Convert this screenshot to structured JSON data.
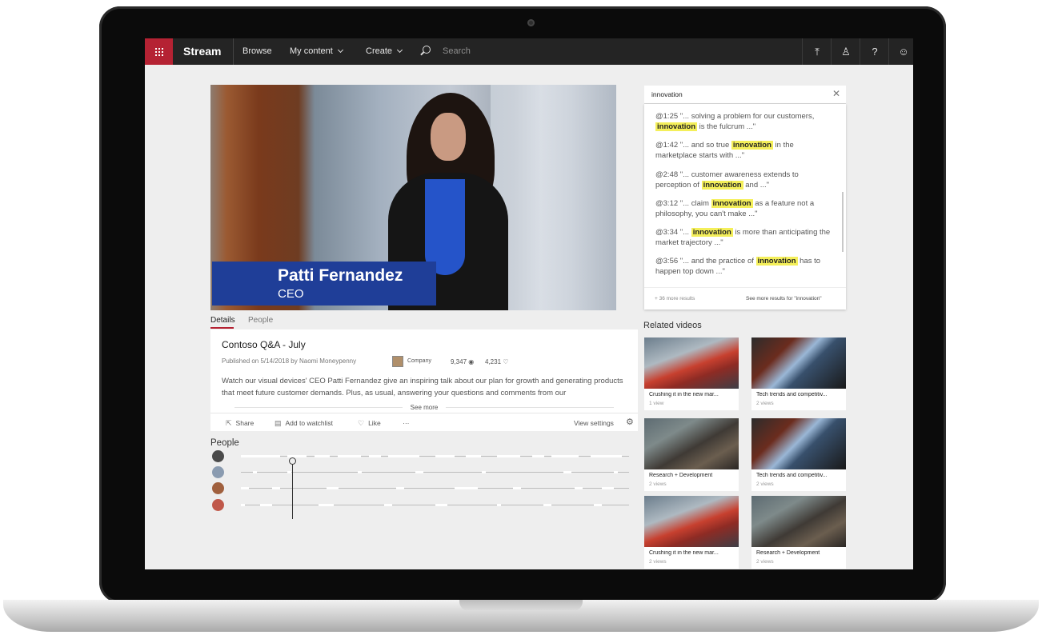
{
  "topbar": {
    "app_name": "Stream",
    "nav": [
      "Browse",
      "My content",
      "Create"
    ],
    "search_placeholder": "Search",
    "icons": [
      "upload-icon",
      "person-icon",
      "help-icon",
      "feedback-smiley-icon"
    ],
    "brand_color": "#b52233"
  },
  "video": {
    "lower_third": {
      "name": "Patti Fernandez",
      "title": "CEO"
    },
    "tabs": [
      "Details",
      "People"
    ],
    "title": "Contoso Q&A - July",
    "published": "Published on 5/14/2018 by Naomi Moneypenny",
    "company": "Company",
    "views": "9,347",
    "likes": "4,231",
    "description": "Watch our visual devices' CEO Patti Fernandez give an inspiring talk about our plan for growth and generating products that meet future customer demands. Plus, as usual, answering your questions and comments from our",
    "see_more": "See more",
    "actions": {
      "share": "Share",
      "watchlist": "Add to watchlist",
      "like": "Like",
      "more": "···",
      "view_settings": "View settings"
    }
  },
  "people": {
    "title": "People",
    "rows": [
      {
        "avatar_color": "#4a4a4a",
        "segments": [
          [
            0.0,
            0.1
          ],
          [
            0.12,
            0.05
          ],
          [
            0.19,
            0.04
          ],
          [
            0.25,
            0.06
          ],
          [
            0.33,
            0.03
          ],
          [
            0.38,
            0.08
          ],
          [
            0.5,
            0.05
          ],
          [
            0.58,
            0.04
          ],
          [
            0.66,
            0.06
          ],
          [
            0.75,
            0.03
          ],
          [
            0.8,
            0.07
          ],
          [
            0.9,
            0.08
          ]
        ]
      },
      {
        "avatar_color": "#8a9bb0",
        "segments": [
          [
            0.03,
            0.01
          ],
          [
            0.12,
            0.01
          ],
          [
            0.3,
            0.01
          ],
          [
            0.45,
            0.02
          ],
          [
            0.62,
            0.01
          ],
          [
            0.83,
            0.02
          ],
          [
            0.96,
            0.01
          ]
        ]
      },
      {
        "avatar_color": "#a0603e",
        "segments": [
          [
            0.0,
            0.02
          ],
          [
            0.08,
            0.02
          ],
          [
            0.22,
            0.03
          ],
          [
            0.4,
            0.02
          ],
          [
            0.55,
            0.06
          ],
          [
            0.7,
            0.02
          ],
          [
            0.86,
            0.02
          ],
          [
            0.93,
            0.03
          ]
        ]
      },
      {
        "avatar_color": "#c0584a",
        "segments": [
          [
            0.0,
            0.01
          ],
          [
            0.05,
            0.03
          ],
          [
            0.2,
            0.04
          ],
          [
            0.37,
            0.02
          ],
          [
            0.5,
            0.03
          ],
          [
            0.66,
            0.01
          ],
          [
            0.78,
            0.02
          ],
          [
            0.91,
            0.02
          ]
        ]
      }
    ]
  },
  "transcript": {
    "query": "innovation",
    "results": [
      {
        "time": "@1:25",
        "before": " \"... solving a problem for our customers, ",
        "after": " is the fulcrum ...\""
      },
      {
        "time": "@1:42",
        "before": " \"... and so true ",
        "after": " in the marketplace starts with ...\""
      },
      {
        "time": "@2:48",
        "before": " \"... customer awareness extends to perception of ",
        "after": " and ...\""
      },
      {
        "time": "@3:12",
        "before": " \"... claim ",
        "after": " as a feature not a philosophy, you can't make ...\""
      },
      {
        "time": "@3:34",
        "before": " \"... ",
        "after": " is more than anticipating the market trajectory ...\""
      },
      {
        "time": "@3:56",
        "before": " \"... and the practice of ",
        "after": " has to happen top down ...\""
      }
    ],
    "more_count": "+ 36 more results",
    "see_more": "See more results for \"innovation\""
  },
  "related": {
    "title": "Related videos",
    "videos": [
      {
        "title": "Crushing it in the new mar...",
        "views": "1 view",
        "thumb": "a"
      },
      {
        "title": "Tech trends and competitiv...",
        "views": "2 views",
        "thumb": "b"
      },
      {
        "title": "Research + Development",
        "views": "2 views",
        "thumb": "c"
      },
      {
        "title": "Tech trends and competitiv...",
        "views": "2 views",
        "thumb": "b"
      },
      {
        "title": "Crushing it in the new mar...",
        "views": "2 views",
        "thumb": "a"
      },
      {
        "title": "Research + Development",
        "views": "2 views",
        "thumb": "c"
      }
    ]
  }
}
